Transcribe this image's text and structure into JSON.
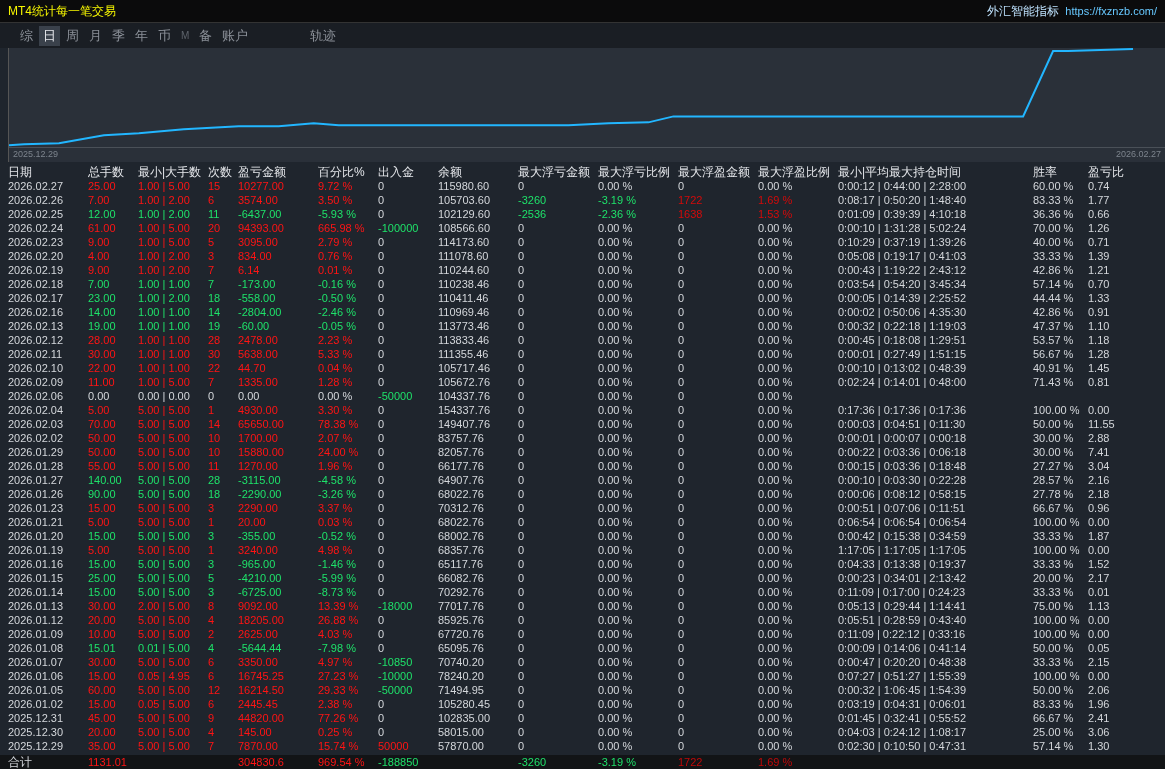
{
  "window": {
    "title": "MT4统计每一笔交易",
    "brand": "外汇智能指标",
    "link": "https://fxznzb.com/"
  },
  "tabs": [
    {
      "label": "综",
      "selected": false,
      "disabled": false
    },
    {
      "label": "日",
      "selected": true,
      "disabled": false
    },
    {
      "label": "周",
      "selected": false,
      "disabled": false
    },
    {
      "label": "月",
      "selected": false,
      "disabled": false
    },
    {
      "label": "季",
      "selected": false,
      "disabled": false
    },
    {
      "label": "年",
      "selected": false,
      "disabled": false
    },
    {
      "label": "币",
      "selected": false,
      "disabled": false
    },
    {
      "label": "M",
      "selected": false,
      "disabled": true
    },
    {
      "label": "备",
      "selected": false,
      "disabled": false
    },
    {
      "label": "账户",
      "selected": false,
      "disabled": false
    }
  ],
  "extra_tabs": [
    {
      "label": "轨迹",
      "selected": false,
      "disabled": false
    }
  ],
  "chart": {
    "start_label": "2025.12.29",
    "end_label": "2026.02.27"
  },
  "table": {
    "columns": [
      "日期",
      "总手数",
      "最小|大手数",
      "次数",
      "盈亏金额",
      "百分比%",
      "出入金",
      "余额",
      "最大浮亏金额",
      "最大浮亏比例",
      "最大浮盈金额",
      "最大浮盈比例",
      "最小|平均最大持仓时间",
      "胜率",
      "盈亏比"
    ],
    "rows": [
      {
        "gain": true,
        "loss": false,
        "deposit": false,
        "withdrawal": false,
        "floating": false,
        "cells": [
          "2026.02.27",
          "25.00",
          "1.00 | 5.00",
          "15",
          "10277.00",
          "9.72 %",
          "0",
          "115980.60",
          "0",
          "0.00 %",
          "0",
          "0.00 %",
          "0:00:12 | 0:44:00 | 2:28:00",
          "60.00 %",
          "0.74"
        ]
      },
      {
        "gain": true,
        "loss": false,
        "deposit": false,
        "withdrawal": false,
        "floating": true,
        "cells": [
          "2026.02.26",
          "7.00",
          "1.00 | 2.00",
          "6",
          "3574.00",
          "3.50 %",
          "0",
          "105703.60",
          "-3260",
          "-3.19 %",
          "1722",
          "1.69 %",
          "0:08:17 | 0:50:20 | 1:48:40",
          "83.33 %",
          "1.77"
        ]
      },
      {
        "gain": false,
        "loss": true,
        "deposit": false,
        "withdrawal": false,
        "floating": true,
        "cells": [
          "2026.02.25",
          "12.00",
          "1.00 | 2.00",
          "11",
          "-6437.00",
          "-5.93 %",
          "0",
          "102129.60",
          "-2536",
          "-2.36 %",
          "1638",
          "1.53 %",
          "0:01:09 | 0:39:39 | 4:10:18",
          "36.36 %",
          "0.66"
        ]
      },
      {
        "gain": true,
        "loss": false,
        "deposit": false,
        "withdrawal": true,
        "floating": false,
        "cells": [
          "2026.02.24",
          "61.00",
          "1.00 | 5.00",
          "20",
          "94393.00",
          "665.98 %",
          "-100000",
          "108566.60",
          "0",
          "0.00 %",
          "0",
          "0.00 %",
          "0:00:10 | 1:31:28 | 5:02:24",
          "70.00 %",
          "1.26"
        ]
      },
      {
        "gain": true,
        "loss": false,
        "deposit": false,
        "withdrawal": false,
        "floating": false,
        "cells": [
          "2026.02.23",
          "9.00",
          "1.00 | 5.00",
          "5",
          "3095.00",
          "2.79 %",
          "0",
          "114173.60",
          "0",
          "0.00 %",
          "0",
          "0.00 %",
          "0:10:29 | 0:37:19 | 1:39:26",
          "40.00 %",
          "0.71"
        ]
      },
      {
        "gain": true,
        "loss": false,
        "deposit": false,
        "withdrawal": false,
        "floating": false,
        "cells": [
          "2026.02.20",
          "4.00",
          "1.00 | 2.00",
          "3",
          "834.00",
          "0.76 %",
          "0",
          "111078.60",
          "0",
          "0.00 %",
          "0",
          "0.00 %",
          "0:05:08 | 0:19:17 | 0:41:03",
          "33.33 %",
          "1.39"
        ]
      },
      {
        "gain": true,
        "loss": false,
        "deposit": false,
        "withdrawal": false,
        "floating": false,
        "cells": [
          "2026.02.19",
          "9.00",
          "1.00 | 2.00",
          "7",
          "6.14",
          "0.01 %",
          "0",
          "110244.60",
          "0",
          "0.00 %",
          "0",
          "0.00 %",
          "0:00:43 | 1:19:22 | 2:43:12",
          "42.86 %",
          "1.21"
        ]
      },
      {
        "gain": false,
        "loss": true,
        "deposit": false,
        "withdrawal": false,
        "floating": false,
        "cells": [
          "2026.02.18",
          "7.00",
          "1.00 | 1.00",
          "7",
          "-173.00",
          "-0.16 %",
          "0",
          "110238.46",
          "0",
          "0.00 %",
          "0",
          "0.00 %",
          "0:03:54 | 0:54:20 | 3:45:34",
          "57.14 %",
          "0.70"
        ]
      },
      {
        "gain": false,
        "loss": true,
        "deposit": false,
        "withdrawal": false,
        "floating": false,
        "cells": [
          "2026.02.17",
          "23.00",
          "1.00 | 2.00",
          "18",
          "-558.00",
          "-0.50 %",
          "0",
          "110411.46",
          "0",
          "0.00 %",
          "0",
          "0.00 %",
          "0:00:05 | 0:14:39 | 2:25:52",
          "44.44 %",
          "1.33"
        ]
      },
      {
        "gain": false,
        "loss": true,
        "deposit": false,
        "withdrawal": false,
        "floating": false,
        "cells": [
          "2026.02.16",
          "14.00",
          "1.00 | 1.00",
          "14",
          "-2804.00",
          "-2.46 %",
          "0",
          "110969.46",
          "0",
          "0.00 %",
          "0",
          "0.00 %",
          "0:00:02 | 0:50:06 | 4:35:30",
          "42.86 %",
          "0.91"
        ]
      },
      {
        "gain": false,
        "loss": true,
        "deposit": false,
        "withdrawal": false,
        "floating": false,
        "cells": [
          "2026.02.13",
          "19.00",
          "1.00 | 1.00",
          "19",
          "-60.00",
          "-0.05 %",
          "0",
          "113773.46",
          "0",
          "0.00 %",
          "0",
          "0.00 %",
          "0:00:32 | 0:22:18 | 1:19:03",
          "47.37 %",
          "1.10"
        ]
      },
      {
        "gain": true,
        "loss": false,
        "deposit": false,
        "withdrawal": false,
        "floating": false,
        "cells": [
          "2026.02.12",
          "28.00",
          "1.00 | 1.00",
          "28",
          "2478.00",
          "2.23 %",
          "0",
          "113833.46",
          "0",
          "0.00 %",
          "0",
          "0.00 %",
          "0:00:45 | 0:18:08 | 1:29:51",
          "53.57 %",
          "1.18"
        ]
      },
      {
        "gain": true,
        "loss": false,
        "deposit": false,
        "withdrawal": false,
        "floating": false,
        "cells": [
          "2026.02.11",
          "30.00",
          "1.00 | 1.00",
          "30",
          "5638.00",
          "5.33 %",
          "0",
          "111355.46",
          "0",
          "0.00 %",
          "0",
          "0.00 %",
          "0:00:01 | 0:27:49 | 1:51:15",
          "56.67 %",
          "1.28"
        ]
      },
      {
        "gain": true,
        "loss": false,
        "deposit": false,
        "withdrawal": false,
        "floating": false,
        "cells": [
          "2026.02.10",
          "22.00",
          "1.00 | 1.00",
          "22",
          "44.70",
          "0.04 %",
          "0",
          "105717.46",
          "0",
          "0.00 %",
          "0",
          "0.00 %",
          "0:00:10 | 0:13:02 | 0:48:39",
          "40.91 %",
          "1.45"
        ]
      },
      {
        "gain": true,
        "loss": false,
        "deposit": false,
        "withdrawal": false,
        "floating": false,
        "cells": [
          "2026.02.09",
          "11.00",
          "1.00 | 5.00",
          "7",
          "1335.00",
          "1.28 %",
          "0",
          "105672.76",
          "0",
          "0.00 %",
          "0",
          "0.00 %",
          "0:02:24 | 0:14:01 | 0:48:00",
          "71.43 %",
          "0.81"
        ]
      },
      {
        "gain": false,
        "loss": false,
        "deposit": false,
        "withdrawal": true,
        "floating": false,
        "cells": [
          "2026.02.06",
          "0.00",
          "0.00 | 0.00",
          "0",
          "0.00",
          "0.00 %",
          "-50000",
          "104337.76",
          "0",
          "0.00 %",
          "0",
          "0.00 %"
        ]
      },
      {
        "gain": true,
        "loss": false,
        "deposit": false,
        "withdrawal": false,
        "floating": false,
        "cells": [
          "2026.02.04",
          "5.00",
          "5.00 | 5.00",
          "1",
          "4930.00",
          "3.30 %",
          "0",
          "154337.76",
          "0",
          "0.00 %",
          "0",
          "0.00 %",
          "0:17:36 | 0:17:36 | 0:17:36",
          "100.00 %",
          "0.00"
        ]
      },
      {
        "gain": true,
        "loss": false,
        "deposit": false,
        "withdrawal": false,
        "floating": false,
        "cells": [
          "2026.02.03",
          "70.00",
          "5.00 | 5.00",
          "14",
          "65650.00",
          "78.38 %",
          "0",
          "149407.76",
          "0",
          "0.00 %",
          "0",
          "0.00 %",
          "0:00:03 | 0:04:51 | 0:11:30",
          "50.00 %",
          "11.55"
        ]
      },
      {
        "gain": true,
        "loss": false,
        "deposit": false,
        "withdrawal": false,
        "floating": false,
        "cells": [
          "2026.02.02",
          "50.00",
          "5.00 | 5.00",
          "10",
          "1700.00",
          "2.07 %",
          "0",
          "83757.76",
          "0",
          "0.00 %",
          "0",
          "0.00 %",
          "0:00:01 | 0:00:07 | 0:00:18",
          "30.00 %",
          "2.88"
        ]
      },
      {
        "gain": true,
        "loss": false,
        "deposit": false,
        "withdrawal": false,
        "floating": false,
        "cells": [
          "2026.01.29",
          "50.00",
          "5.00 | 5.00",
          "10",
          "15880.00",
          "24.00 %",
          "0",
          "82057.76",
          "0",
          "0.00 %",
          "0",
          "0.00 %",
          "0:00:22 | 0:03:36 | 0:06:18",
          "30.00 %",
          "7.41"
        ]
      },
      {
        "gain": true,
        "loss": false,
        "deposit": false,
        "withdrawal": false,
        "floating": false,
        "cells": [
          "2026.01.28",
          "55.00",
          "5.00 | 5.00",
          "11",
          "1270.00",
          "1.96 %",
          "0",
          "66177.76",
          "0",
          "0.00 %",
          "0",
          "0.00 %",
          "0:00:15 | 0:03:36 | 0:18:48",
          "27.27 %",
          "3.04"
        ]
      },
      {
        "gain": false,
        "loss": true,
        "deposit": false,
        "withdrawal": false,
        "floating": false,
        "cells": [
          "2026.01.27",
          "140.00",
          "5.00 | 5.00",
          "28",
          "-3115.00",
          "-4.58 %",
          "0",
          "64907.76",
          "0",
          "0.00 %",
          "0",
          "0.00 %",
          "0:00:10 | 0:03:30 | 0:22:28",
          "28.57 %",
          "2.16"
        ]
      },
      {
        "gain": false,
        "loss": true,
        "deposit": false,
        "withdrawal": false,
        "floating": false,
        "cells": [
          "2026.01.26",
          "90.00",
          "5.00 | 5.00",
          "18",
          "-2290.00",
          "-3.26 %",
          "0",
          "68022.76",
          "0",
          "0.00 %",
          "0",
          "0.00 %",
          "0:00:06 | 0:08:12 | 0:58:15",
          "27.78 %",
          "2.18"
        ]
      },
      {
        "gain": true,
        "loss": false,
        "deposit": false,
        "withdrawal": false,
        "floating": false,
        "cells": [
          "2026.01.23",
          "15.00",
          "5.00 | 5.00",
          "3",
          "2290.00",
          "3.37 %",
          "0",
          "70312.76",
          "0",
          "0.00 %",
          "0",
          "0.00 %",
          "0:00:51 | 0:07:06 | 0:11:51",
          "66.67 %",
          "0.96"
        ]
      },
      {
        "gain": true,
        "loss": false,
        "deposit": false,
        "withdrawal": false,
        "floating": false,
        "cells": [
          "2026.01.21",
          "5.00",
          "5.00 | 5.00",
          "1",
          "20.00",
          "0.03 %",
          "0",
          "68022.76",
          "0",
          "0.00 %",
          "0",
          "0.00 %",
          "0:06:54 | 0:06:54 | 0:06:54",
          "100.00 %",
          "0.00"
        ]
      },
      {
        "gain": false,
        "loss": true,
        "deposit": false,
        "withdrawal": false,
        "floating": false,
        "cells": [
          "2026.01.20",
          "15.00",
          "5.00 | 5.00",
          "3",
          "-355.00",
          "-0.52 %",
          "0",
          "68002.76",
          "0",
          "0.00 %",
          "0",
          "0.00 %",
          "0:00:42 | 0:15:38 | 0:34:59",
          "33.33 %",
          "1.87"
        ]
      },
      {
        "gain": true,
        "loss": false,
        "deposit": false,
        "withdrawal": false,
        "floating": false,
        "cells": [
          "2026.01.19",
          "5.00",
          "5.00 | 5.00",
          "1",
          "3240.00",
          "4.98 %",
          "0",
          "68357.76",
          "0",
          "0.00 %",
          "0",
          "0.00 %",
          "1:17:05 | 1:17:05 | 1:17:05",
          "100.00 %",
          "0.00"
        ]
      },
      {
        "gain": false,
        "loss": true,
        "deposit": false,
        "withdrawal": false,
        "floating": false,
        "cells": [
          "2026.01.16",
          "15.00",
          "5.00 | 5.00",
          "3",
          "-965.00",
          "-1.46 %",
          "0",
          "65117.76",
          "0",
          "0.00 %",
          "0",
          "0.00 %",
          "0:04:33 | 0:13:38 | 0:19:37",
          "33.33 %",
          "1.52"
        ]
      },
      {
        "gain": false,
        "loss": true,
        "deposit": false,
        "withdrawal": false,
        "floating": false,
        "cells": [
          "2026.01.15",
          "25.00",
          "5.00 | 5.00",
          "5",
          "-4210.00",
          "-5.99 %",
          "0",
          "66082.76",
          "0",
          "0.00 %",
          "0",
          "0.00 %",
          "0:00:23 | 0:34:01 | 2:13:42",
          "20.00 %",
          "2.17"
        ]
      },
      {
        "gain": false,
        "loss": true,
        "deposit": false,
        "withdrawal": false,
        "floating": false,
        "cells": [
          "2026.01.14",
          "15.00",
          "5.00 | 5.00",
          "3",
          "-6725.00",
          "-8.73 %",
          "0",
          "70292.76",
          "0",
          "0.00 %",
          "0",
          "0.00 %",
          "0:11:09 | 0:17:00 | 0:24:23",
          "33.33 %",
          "0.01"
        ]
      },
      {
        "gain": true,
        "loss": false,
        "deposit": false,
        "withdrawal": true,
        "floating": false,
        "cells": [
          "2026.01.13",
          "30.00",
          "2.00 | 5.00",
          "8",
          "9092.00",
          "13.39 %",
          "-18000",
          "77017.76",
          "0",
          "0.00 %",
          "0",
          "0.00 %",
          "0:05:13 | 0:29:44 | 1:14:41",
          "75.00 %",
          "1.13"
        ]
      },
      {
        "gain": true,
        "loss": false,
        "deposit": false,
        "withdrawal": false,
        "floating": false,
        "cells": [
          "2026.01.12",
          "20.00",
          "5.00 | 5.00",
          "4",
          "18205.00",
          "26.88 %",
          "0",
          "85925.76",
          "0",
          "0.00 %",
          "0",
          "0.00 %",
          "0:05:51 | 0:28:59 | 0:43:40",
          "100.00 %",
          "0.00"
        ]
      },
      {
        "gain": true,
        "loss": false,
        "deposit": false,
        "withdrawal": false,
        "floating": false,
        "cells": [
          "2026.01.09",
          "10.00",
          "5.00 | 5.00",
          "2",
          "2625.00",
          "4.03 %",
          "0",
          "67720.76",
          "0",
          "0.00 %",
          "0",
          "0.00 %",
          "0:11:09 | 0:22:12 | 0:33:16",
          "100.00 %",
          "0.00"
        ]
      },
      {
        "gain": false,
        "loss": true,
        "deposit": false,
        "withdrawal": false,
        "floating": false,
        "cells": [
          "2026.01.08",
          "15.01",
          "0.01 | 5.00",
          "4",
          "-5644.44",
          "-7.98 %",
          "0",
          "65095.76",
          "0",
          "0.00 %",
          "0",
          "0.00 %",
          "0:00:09 | 0:14:06 | 0:41:14",
          "50.00 %",
          "0.05"
        ]
      },
      {
        "gain": true,
        "loss": false,
        "deposit": false,
        "withdrawal": true,
        "floating": false,
        "cells": [
          "2026.01.07",
          "30.00",
          "5.00 | 5.00",
          "6",
          "3350.00",
          "4.97 %",
          "-10850",
          "70740.20",
          "0",
          "0.00 %",
          "0",
          "0.00 %",
          "0:00:47 | 0:20:20 | 0:48:38",
          "33.33 %",
          "2.15"
        ]
      },
      {
        "gain": true,
        "loss": false,
        "deposit": false,
        "withdrawal": true,
        "floating": false,
        "cells": [
          "2026.01.06",
          "15.00",
          "0.05 | 4.95",
          "6",
          "16745.25",
          "27.23 %",
          "-10000",
          "78240.20",
          "0",
          "0.00 %",
          "0",
          "0.00 %",
          "0:07:27 | 0:51:27 | 1:55:39",
          "100.00 %",
          "0.00"
        ]
      },
      {
        "gain": true,
        "loss": false,
        "deposit": false,
        "withdrawal": true,
        "floating": false,
        "cells": [
          "2026.01.05",
          "60.00",
          "5.00 | 5.00",
          "12",
          "16214.50",
          "29.33 %",
          "-50000",
          "71494.95",
          "0",
          "0.00 %",
          "0",
          "0.00 %",
          "0:00:32 | 1:06:45 | 1:54:39",
          "50.00 %",
          "2.06"
        ]
      },
      {
        "gain": true,
        "loss": false,
        "deposit": false,
        "withdrawal": false,
        "floating": false,
        "cells": [
          "2026.01.02",
          "15.00",
          "0.05 | 5.00",
          "6",
          "2445.45",
          "2.38 %",
          "0",
          "105280.45",
          "0",
          "0.00 %",
          "0",
          "0.00 %",
          "0:03:19 | 0:04:31 | 0:06:01",
          "83.33 %",
          "1.96"
        ]
      },
      {
        "gain": true,
        "loss": false,
        "deposit": false,
        "withdrawal": false,
        "floating": false,
        "cells": [
          "2025.12.31",
          "45.00",
          "5.00 | 5.00",
          "9",
          "44820.00",
          "77.26 %",
          "0",
          "102835.00",
          "0",
          "0.00 %",
          "0",
          "0.00 %",
          "0:01:45 | 0:32:41 | 0:55:52",
          "66.67 %",
          "2.41"
        ]
      },
      {
        "gain": true,
        "loss": false,
        "deposit": false,
        "withdrawal": false,
        "floating": false,
        "cells": [
          "2025.12.30",
          "20.00",
          "5.00 | 5.00",
          "4",
          "145.00",
          "0.25 %",
          "0",
          "58015.00",
          "0",
          "0.00 %",
          "0",
          "0.00 %",
          "0:04:03 | 0:24:12 | 1:08:17",
          "25.00 %",
          "3.06"
        ]
      },
      {
        "gain": true,
        "loss": false,
        "deposit": true,
        "withdrawal": false,
        "floating": false,
        "cells": [
          "2025.12.29",
          "35.00",
          "5.00 | 5.00",
          "7",
          "7870.00",
          "15.74 %",
          "50000",
          "57870.00",
          "0",
          "0.00 %",
          "0",
          "0.00 %",
          "0:02:30 | 0:10:50 | 0:47:31",
          "57.14 %",
          "1.30"
        ]
      }
    ],
    "totals": {
      "label": "合计",
      "gain": true,
      "loss": false,
      "deposit": false,
      "withdrawal": true,
      "floating": true,
      "lots": "1131.01",
      "pnl": "304830.6",
      "pct": "969.54 %",
      "flow": "-188850",
      "float_loss": "-3260",
      "float_loss_pct": "-3.19 %",
      "float_gain": "1722",
      "float_gain_pct": "1.69 %"
    }
  }
}
